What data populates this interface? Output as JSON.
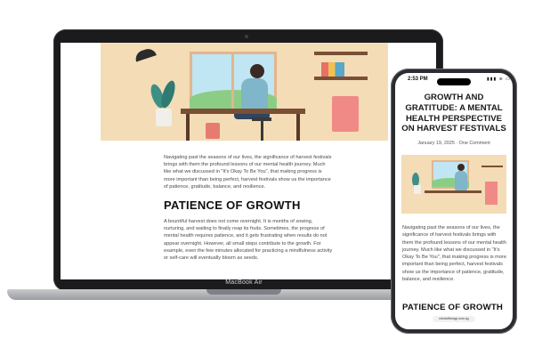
{
  "laptop": {
    "brand_label": "MacBook Air",
    "article_paragraph": "Navigating past the seasons of our lives, the significance of harvest festivals brings with them the profound lessons of our mental health journey. Much like what we discussed in \"It's Okay To Be You\", that making progress is more important than being perfect, harvest festivals show us the importance of patience, gratitude, balance, and resilience.",
    "section_heading": "PATIENCE OF GROWTH",
    "section_paragraph": "A bountiful harvest does not come overnight. It is months of sowing, nurturing, and waiting to finally reap its fruits. Sometimes, the progress of mental health requires patience, and it gets frustrating when results do not appear overnight. However, all small steps contribute to the growth. For example, even the few minutes allocated for practicing a mindfulness activity or self-care will eventually bloom as seeds."
  },
  "phone": {
    "status_time": "2:53 PM",
    "status_icons": "▮▮▮ ≋ ▭",
    "title": "GROWTH AND GRATITUDE: A MENTAL HEALTH PERSPECTIVE ON HARVEST FESTIVALS",
    "meta": "January 19, 2025 · One Comment",
    "paragraph": "Navigating past the seasons of our lives, the significance of harvest festivals brings with them the profound lessons of our mental health journey. Much like what we discussed in \"It's Okay To Be You\", that making progress is more important than being perfect, harvest festivals show us the importance of patience, gratitude, balance, and resilience.",
    "section_heading": "PATIENCE OF GROWTH",
    "url": "mindoftheagr.com.sg"
  }
}
